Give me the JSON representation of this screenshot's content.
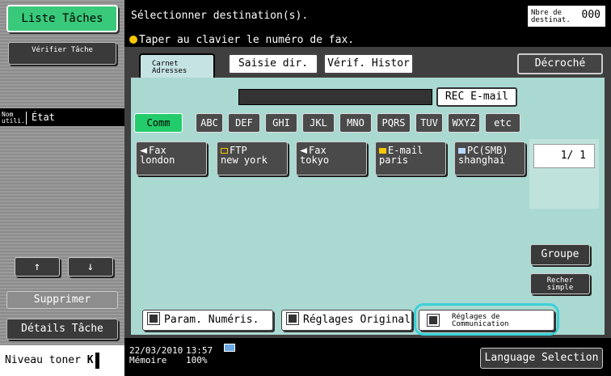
{
  "left": {
    "job_list": "Liste Tâches",
    "verify_job": "Vérifier Tâche",
    "col_user": "Nom utili.",
    "col_state": "État",
    "up_arrow": "↑",
    "down_arrow": "↓",
    "delete": "Supprimer",
    "job_details": "Détails Tâche",
    "toner_label": "Niveau toner",
    "toner_color": "K"
  },
  "header": {
    "title": "Sélectionner destination(s).",
    "dest_count_label": "Nbre de destinat.",
    "dest_count_value": "000",
    "hint": "Taper au clavier le numéro de fax."
  },
  "tabs": {
    "address_book": "Carnet Adresses",
    "direct_input": "Saisie dir.",
    "history": "Vérif. Histor",
    "off_hook": "Décroché"
  },
  "rec_email": "REC E-mail",
  "index_tabs": [
    "Comm",
    "ABC",
    "DEF",
    "GHI",
    "JKL",
    "MNO",
    "PQRS",
    "TUV",
    "WXYZ",
    "etc"
  ],
  "destinations": [
    {
      "type": "Fax",
      "name": "london",
      "icon": "fax-icon"
    },
    {
      "type": "FTP",
      "name": "new york",
      "icon": "ftp-icon"
    },
    {
      "type": "Fax",
      "name": "tokyo",
      "icon": "fax-icon"
    },
    {
      "type": "E-mail",
      "name": "paris",
      "icon": "mail-icon"
    },
    {
      "type": "PC(SMB)",
      "name": "shanghai",
      "icon": "pc-icon"
    }
  ],
  "pager": "1/ 1",
  "side": {
    "group": "Groupe",
    "simple_search": "Recher simple"
  },
  "bottom_buttons": {
    "scan_settings": "Param. Numéris.",
    "original_settings": "Réglages Original",
    "comm_settings": "Réglages de Communication"
  },
  "status": {
    "date": "22/03/2010",
    "time": "13:57",
    "memory_label": "Mémoire",
    "memory_value": "100%",
    "language": "Language Selection"
  },
  "colors": {
    "accent_green": "#38c97a",
    "panel_teal": "#aad9d2",
    "highlight_ring": "#3bd1d9"
  }
}
